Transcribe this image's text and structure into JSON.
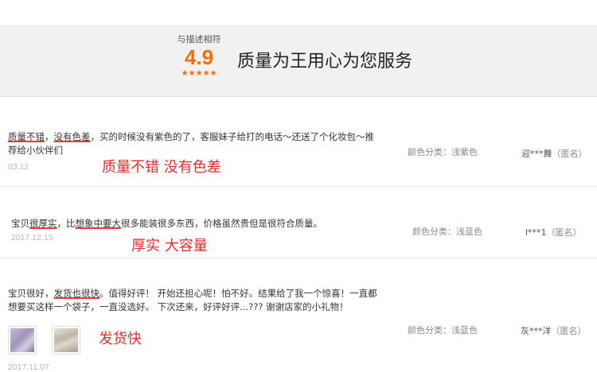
{
  "banner": {
    "rating_label": "与描述相符",
    "rating_score": "4.9",
    "rating_stars": "★★★★★",
    "slogan": "质量为王用心为您服务"
  },
  "reviews": [
    {
      "text_parts": [
        {
          "t": "质量不错",
          "u": true
        },
        {
          "t": "，",
          "u": false
        },
        {
          "t": "没有色差",
          "u": true
        },
        {
          "t": "，买的时候没有紫色的了，客服妹子给打的电话～还送了个化妆包～推荐给小伙伴们",
          "u": false
        }
      ],
      "date": "03.12",
      "sku": "颜色分类：浅紫色",
      "user": "迎***舞",
      "anon": "（匿名）",
      "annotation": "质量不错 没有色差"
    },
    {
      "text_parts": [
        {
          "t": "宝贝",
          "u": false
        },
        {
          "t": "很厚实",
          "u": true
        },
        {
          "t": "，比",
          "u": false
        },
        {
          "t": "想象中要大",
          "u": true
        },
        {
          "t": "很多能装很多东西，价格虽然贵但是很符合质量。",
          "u": false
        }
      ],
      "date": "2017.12.15",
      "sku": "颜色分类：浅蓝色",
      "user": "l***1",
      "anon": "（匿名）",
      "annotation": "厚实 大容量"
    },
    {
      "text_parts": [
        {
          "t": "宝贝很好，",
          "u": false
        },
        {
          "t": "发货也很快",
          "u": true
        },
        {
          "t": "。值得好评！ 开始还担心呢！怕不好。结果给了我一个惊喜！一直都想要买这样一个袋子，一直没选好。 下次还来，好评好评...??? 谢谢店家的小礼物！",
          "u": false
        }
      ],
      "date": "2017.11.07",
      "sku": "颜色分类：浅蓝色",
      "user": "灰***洋",
      "anon": "（匿名）",
      "annotation": "发货快"
    }
  ],
  "colors": {
    "accent": "#ff6a00",
    "annotation": "#e52b2b",
    "underline": "#e4393c"
  }
}
